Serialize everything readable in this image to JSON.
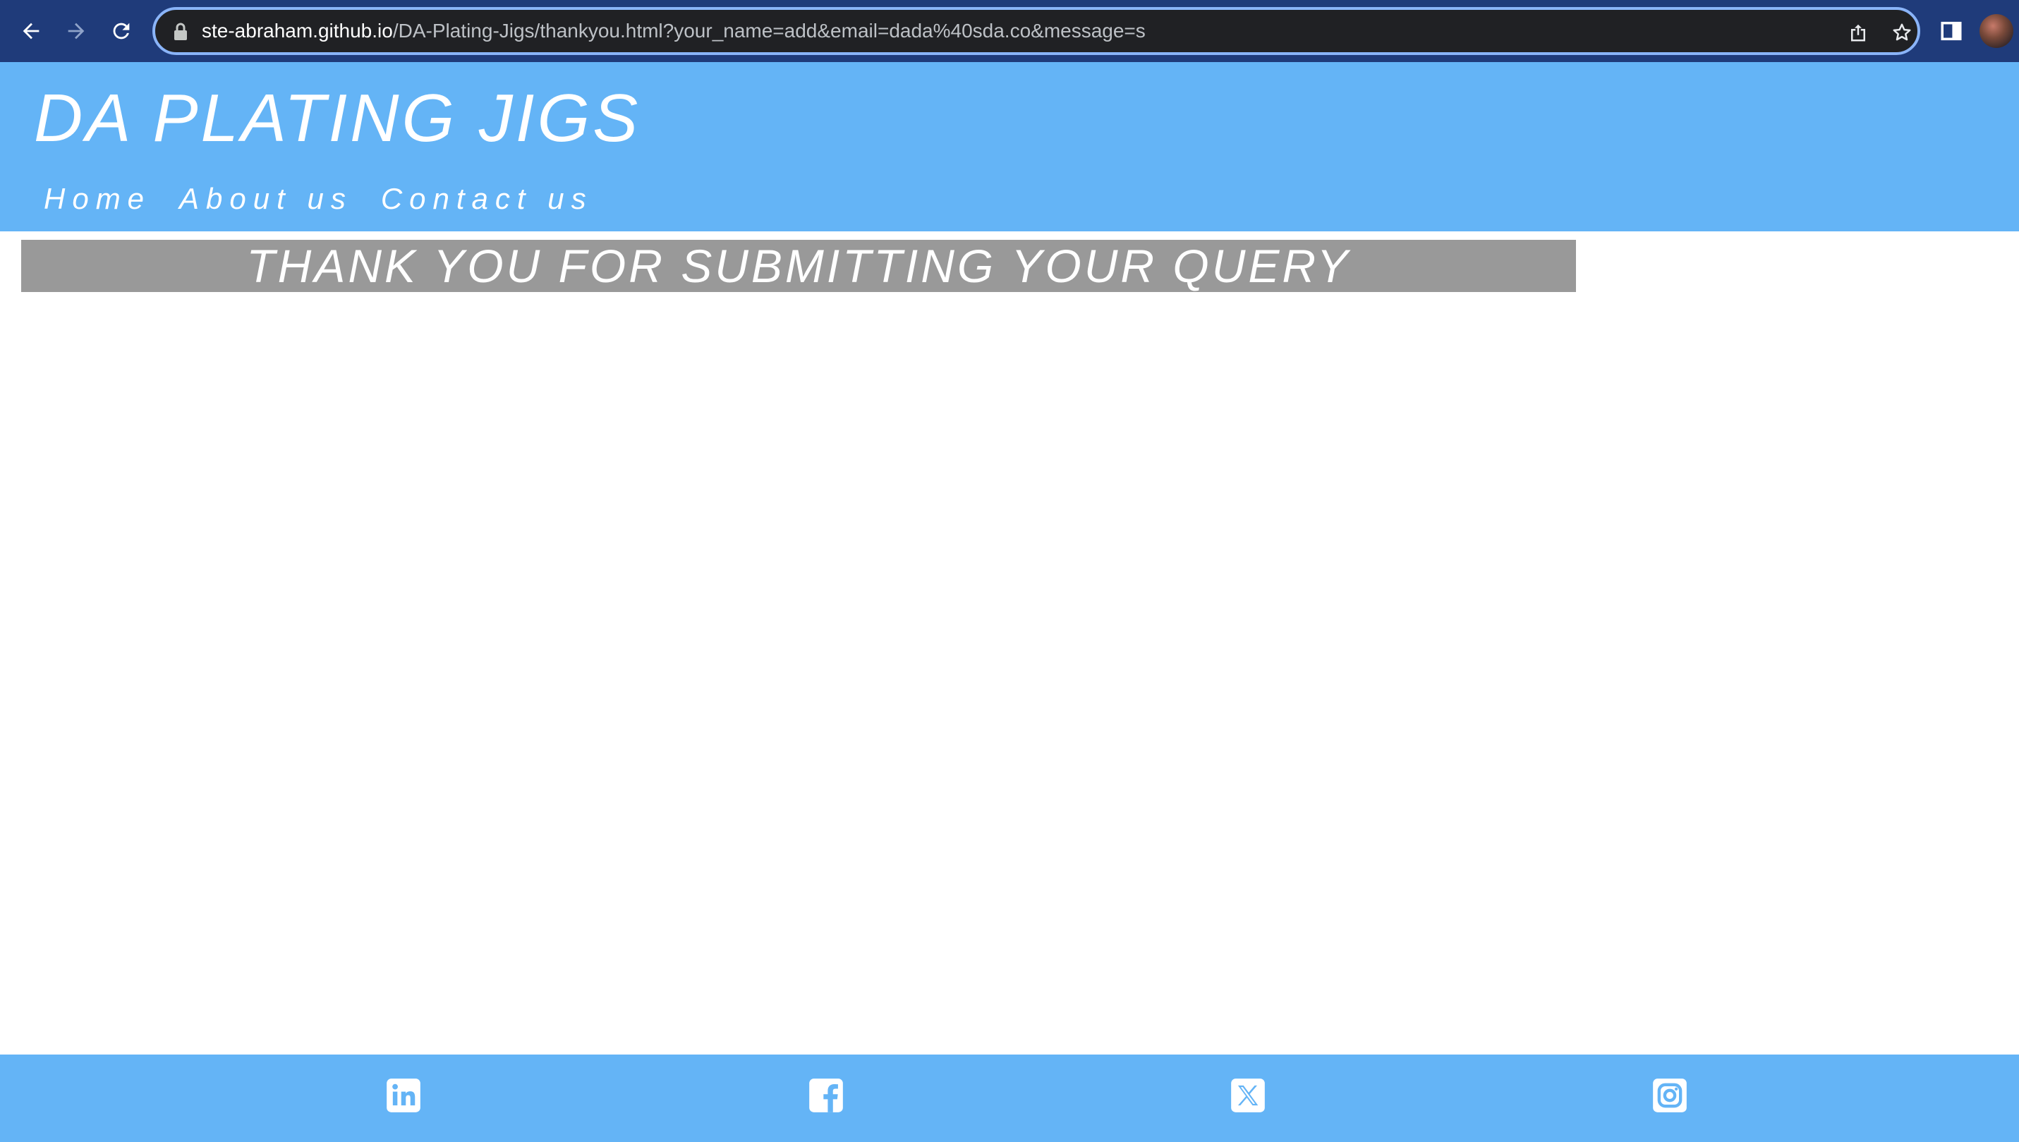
{
  "browser": {
    "url_host": "ste-abraham.github.io",
    "url_path": "/DA-Plating-Jigs/thankyou.html?your_name=add&email=dada%40sda.co&message=s",
    "icons": [
      "back-icon",
      "forward-icon",
      "reload-icon",
      "lock-icon",
      "share-icon",
      "bookmark-star-icon",
      "side-panel-icon",
      "profile-avatar"
    ]
  },
  "header": {
    "title": "DA PLATING JIGS",
    "nav": [
      "Home",
      "About us",
      "Contact us"
    ]
  },
  "main": {
    "message": "THANK YOU FOR SUBMITTING YOUR QUERY"
  },
  "footer": {
    "social": [
      "linkedin-icon",
      "facebook-icon",
      "x-twitter-icon",
      "instagram-icon"
    ]
  },
  "colors": {
    "chrome": "#1f3b7a",
    "header": "#64b4f6",
    "banner": "#999999",
    "text": "#ffffff"
  }
}
